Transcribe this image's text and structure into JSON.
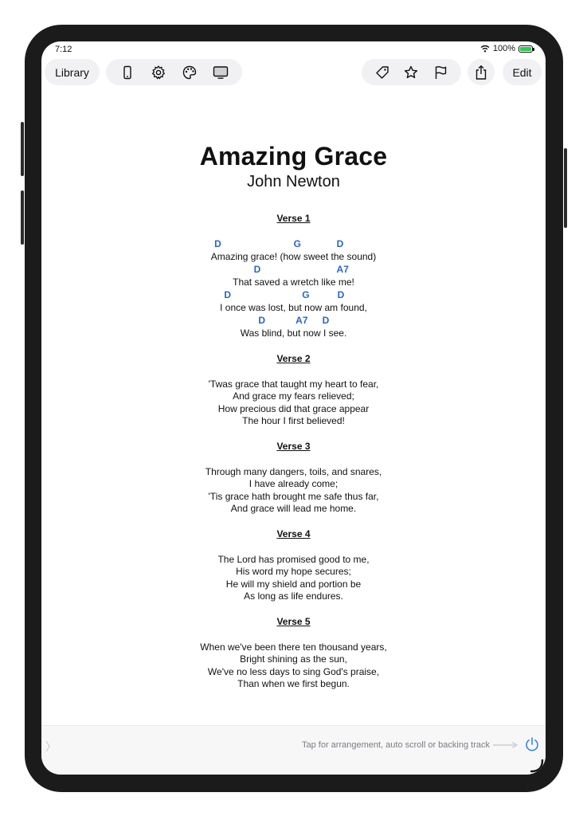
{
  "status_bar": {
    "time": "7:12",
    "battery": "100%"
  },
  "toolbar": {
    "library_label": "Library",
    "edit_label": "Edit",
    "icons": [
      "phone-icon",
      "gear-icon",
      "palette-icon",
      "monitor-icon",
      "tag-icon",
      "star-icon",
      "flag-icon",
      "share-icon"
    ]
  },
  "song": {
    "title": "Amazing Grace",
    "author": "John Newton",
    "verse1": {
      "heading": "Verse 1",
      "lines": [
        {
          "chords": [
            {
              "c": "D",
              "pos": 0.04
            },
            {
              "c": "G",
              "pos": 0.52
            },
            {
              "c": "D",
              "pos": 0.78
            }
          ],
          "text": "Amazing grace! (how sweet the sound)"
        },
        {
          "chords": [
            {
              "c": "D",
              "pos": 0.2
            },
            {
              "c": "A7",
              "pos": 0.88
            }
          ],
          "text": "That saved a wretch like me!"
        },
        {
          "chords": [
            {
              "c": "D",
              "pos": 0.05
            },
            {
              "c": "G",
              "pos": 0.58
            },
            {
              "c": "D",
              "pos": 0.82
            }
          ],
          "text": "I once was lost, but now am found,"
        },
        {
          "chords": [
            {
              "c": "D",
              "pos": 0.2
            },
            {
              "c": "A7",
              "pos": 0.55
            },
            {
              "c": "D",
              "pos": 0.8
            }
          ],
          "text": "Was blind, but now I see."
        }
      ]
    },
    "verses": [
      {
        "heading": "Verse 2",
        "lines": [
          "'Twas grace that taught my heart to fear,",
          "And grace my fears relieved;",
          "How precious did that grace appear",
          "The hour I first believed!"
        ]
      },
      {
        "heading": "Verse 3",
        "lines": [
          "Through many dangers, toils, and snares,",
          "I have already come;",
          "'Tis grace hath brought me safe thus far,",
          "And grace will lead me home."
        ]
      },
      {
        "heading": "Verse 4",
        "lines": [
          "The Lord has promised good to me,",
          "His word my hope secures;",
          "He will my shield and portion be",
          "As long as life endures."
        ]
      },
      {
        "heading": "Verse 5",
        "lines": [
          "When we've been there ten thousand years,",
          "Bright shining as the sun,",
          "We've no less days to sing God's praise,",
          "Than when we first begun."
        ]
      }
    ]
  },
  "bottom_bar": {
    "chevron": "〉",
    "hint": "Tap for arrangement, auto scroll or backing track"
  },
  "colors": {
    "chord": "#2b64c5",
    "battery": "#33c759",
    "accent": "#2f7bf5"
  }
}
